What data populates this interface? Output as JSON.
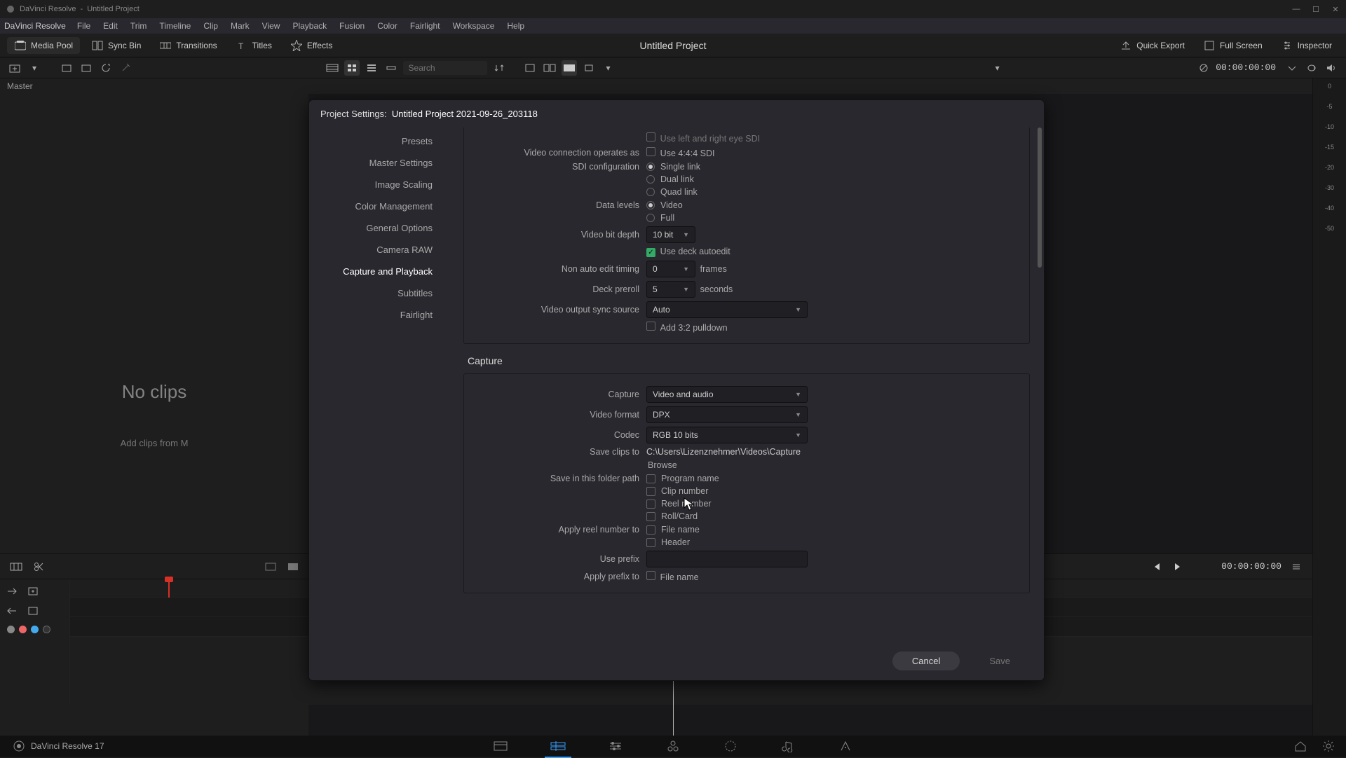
{
  "titlebar": {
    "appName": "DaVinci Resolve",
    "doc": "Untitled Project"
  },
  "menus": [
    "File",
    "Edit",
    "Trim",
    "Timeline",
    "Clip",
    "Mark",
    "View",
    "Playback",
    "Fusion",
    "Color",
    "Fairlight",
    "Workspace",
    "Help"
  ],
  "toolbar": {
    "mediaPool": "Media Pool",
    "syncBin": "Sync Bin",
    "transitions": "Transitions",
    "titles": "Titles",
    "effects": "Effects",
    "projectTitle": "Untitled Project",
    "quickExport": "Quick Export",
    "fullScreen": "Full Screen",
    "inspector": "Inspector"
  },
  "secondbar": {
    "searchPlaceholder": "Search",
    "timecode": "00:00:00:00"
  },
  "masterLabel": "Master",
  "mediaPanel": {
    "noclips": "No clips",
    "hint": "Add clips from M"
  },
  "vmeter": {
    "ticks": [
      "0",
      "-5",
      "-10",
      "-15",
      "-20",
      "-30",
      "-40",
      "-50"
    ]
  },
  "transport": {
    "tcRight": "00:00:00:00"
  },
  "modal": {
    "title": "Project Settings:",
    "projectName": "Untitled Project 2021-09-26_203118",
    "categories": [
      "Presets",
      "Master Settings",
      "Image Scaling",
      "Color Management",
      "General Options",
      "Camera RAW",
      "Capture and Playback",
      "Subtitles",
      "Fairlight"
    ],
    "activeCategory": "Capture and Playback",
    "video": {
      "useLeftRightSDI": "Use left and right eye SDI",
      "videoConnLabel": "Video connection operates as",
      "use444": "Use 4:4:4 SDI",
      "sdiConfigLabel": "SDI configuration",
      "sdiOptions": [
        "Single link",
        "Dual link",
        "Quad link"
      ],
      "dataLevelsLabel": "Data levels",
      "dataLevelOptions": [
        "Video",
        "Full"
      ],
      "videoBitDepthLabel": "Video bit depth",
      "videoBitDepthValue": "10 bit",
      "useDeckAutoedit": "Use deck autoedit",
      "nonAutoEditLabel": "Non auto edit timing",
      "nonAutoEditValue": "0",
      "nonAutoEditUnit": "frames",
      "deckPrerollLabel": "Deck preroll",
      "deckPrerollValue": "5",
      "deckPrerollUnit": "seconds",
      "videoOutputSyncLabel": "Video output sync source",
      "videoOutputSyncValue": "Auto",
      "add32": "Add 3:2 pulldown"
    },
    "captureSection": {
      "heading": "Capture",
      "captureLabel": "Capture",
      "captureValue": "Video and audio",
      "formatLabel": "Video format",
      "formatValue": "DPX",
      "codecLabel": "Codec",
      "codecValue": "RGB 10 bits",
      "saveClipsLabel": "Save clips to",
      "saveClipsValue": "C:\\Users\\Lizenznehmer\\Videos\\Capture",
      "browse": "Browse",
      "folderPathLabel": "Save in this folder path",
      "folderOptions": [
        "Program name",
        "Clip number",
        "Reel number",
        "Roll/Card"
      ],
      "applyReelLabel": "Apply reel number to",
      "applyReelOptions": [
        "File name",
        "Header"
      ],
      "usePrefixLabel": "Use prefix",
      "applyPrefixLabel": "Apply prefix to",
      "applyPrefixOptions": [
        "File name"
      ]
    },
    "cancel": "Cancel",
    "save": "Save"
  },
  "bottom": {
    "appVersion": "DaVinci Resolve 17"
  }
}
